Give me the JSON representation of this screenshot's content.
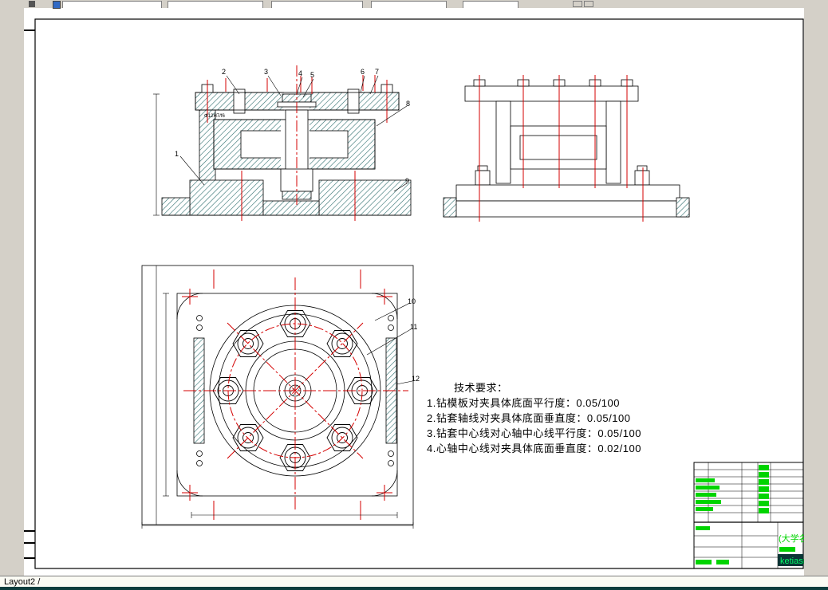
{
  "chrome": {
    "layout_tab": "Layout2 /"
  },
  "tech_requirements": {
    "title": "技术要求：",
    "items": [
      "1.钻模板对夹具体底面平行度：0.05/100",
      "2.钻套轴线对夹具体底面垂直度：0.05/100",
      "3.钻套中心线对心轴中心线平行度：0.05/100",
      "4.心轴中心线对夹具体底面垂直度：0.02/100"
    ]
  },
  "balloons": {
    "front": [
      "1",
      "2",
      "3",
      "4",
      "5",
      "6",
      "7",
      "8",
      "9"
    ],
    "plan": [
      "10",
      "11",
      "12"
    ]
  },
  "annotations": {
    "fit": "Φ12H7/f6"
  },
  "title_block": {
    "university": "(大学名",
    "author": "ketiasn"
  },
  "colors": {
    "hatch": "#2e6e6e",
    "centerline": "#d40000",
    "accent_green": "#00d400",
    "statusbar": "#0d3d3d",
    "chrome_gray": "#d4d0c8"
  }
}
